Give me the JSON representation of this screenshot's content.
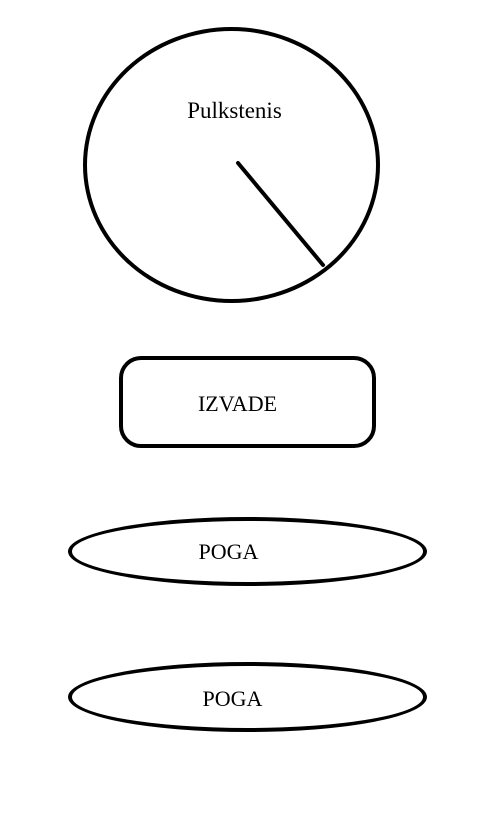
{
  "clock": {
    "title": "Pulkstenis"
  },
  "buttons": {
    "izvade_label": "IZVADE",
    "poga_1_label": "POGA",
    "poga_2_label": "POGA"
  }
}
